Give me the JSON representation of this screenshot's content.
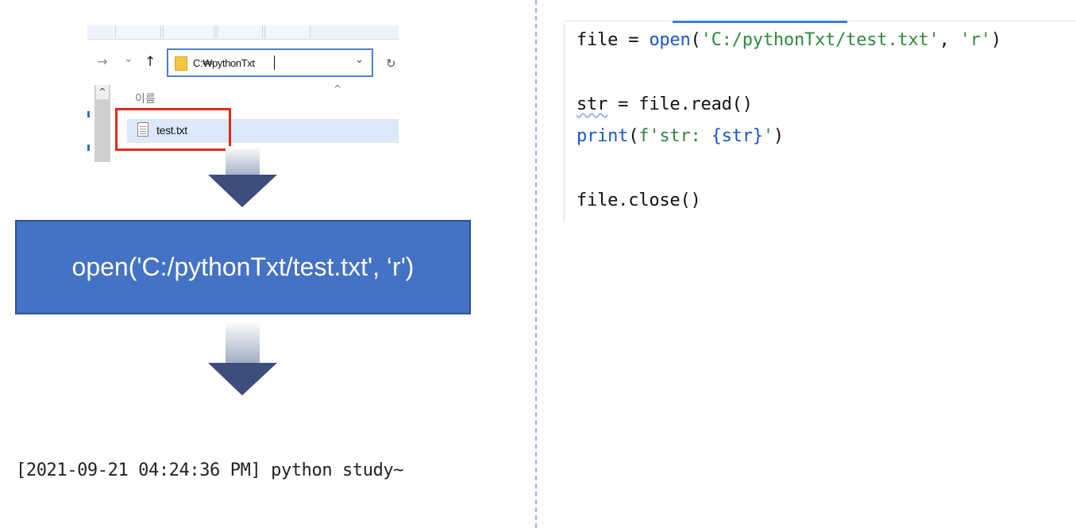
{
  "explorer": {
    "address_path": "C:₩pythonTxt",
    "column_name_header": "이름",
    "selected_file": "test.txt",
    "nav": {
      "back": "←",
      "forward": "→",
      "recent": "⌄",
      "up": "↑",
      "dropdown": "⌄",
      "refresh": "↻",
      "sort": "^",
      "scroll_up": "^"
    }
  },
  "flow": {
    "box_text": "open('C:/pythonTxt/test.txt', ‘r')",
    "output_line": "[2021-09-21 04:24:36 PM] python study~"
  },
  "code": {
    "line1": {
      "a": "file = ",
      "b": "open",
      "c": "(",
      "d": "'C:/pythonTxt/test.txt'",
      "e": ", ",
      "f": "'r'",
      "g": ")"
    },
    "line2": {
      "a": "str",
      "b": " = file.read()"
    },
    "line3": {
      "a": "print",
      "b": "(",
      "c": "f'str: ",
      "d": "{str}",
      "e": "'",
      "f": ")"
    },
    "line4": {
      "a": "file.close()"
    }
  },
  "colors": {
    "box_fill": "#4472c4",
    "highlight_border": "#e02b20",
    "string_green": "#2f8a3c",
    "builtin_blue": "#1b55c9",
    "arrow_dark": "#3d4d7c"
  }
}
